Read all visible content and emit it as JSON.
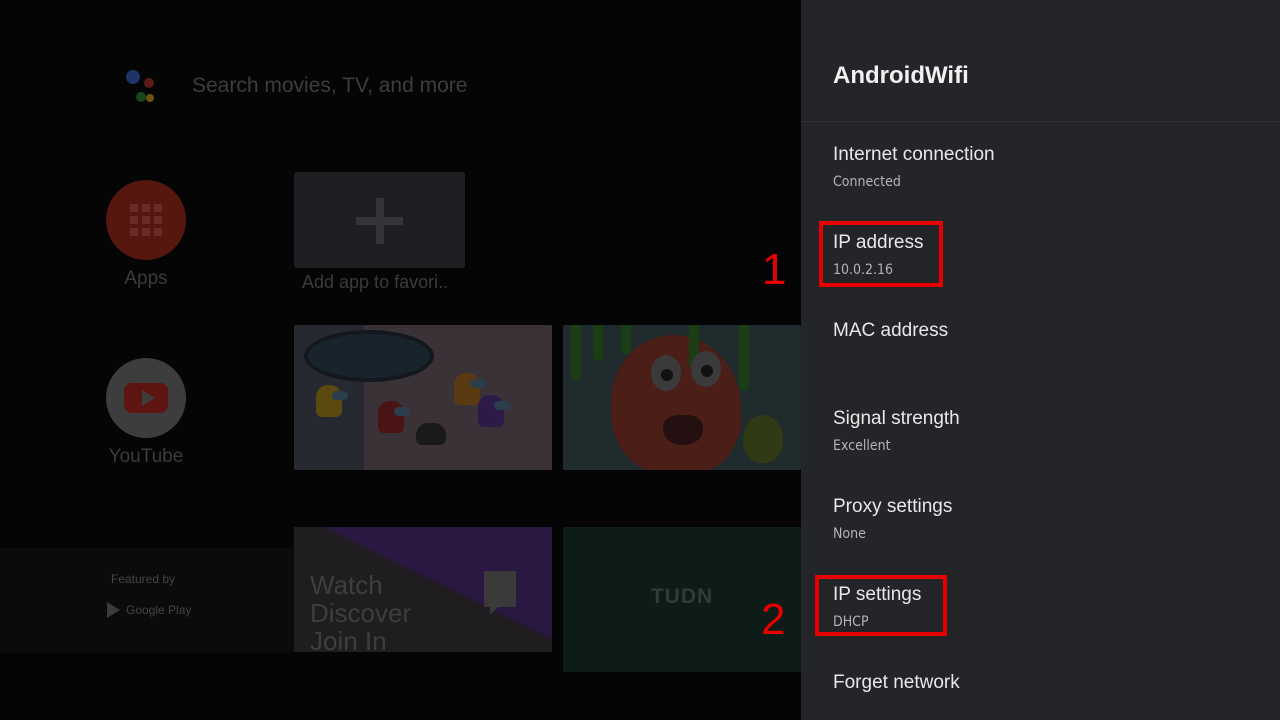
{
  "home": {
    "search_placeholder": "Search movies, TV, and more",
    "apps_label": "Apps",
    "youtube_label": "YouTube",
    "add_app_label": "Add app to favori..",
    "featured_by": "Featured by",
    "google_play": "Google Play",
    "twitch_text": "Watch\nDiscover\nJoin In",
    "tudn_text": "TUDN"
  },
  "panel": {
    "title": "AndroidWifi",
    "items": [
      {
        "title": "Internet connection",
        "value": "Connected"
      },
      {
        "title": "IP address",
        "value": "10.0.2.16"
      },
      {
        "title": "MAC address",
        "value": ""
      },
      {
        "title": "Signal strength",
        "value": "Excellent"
      },
      {
        "title": "Proxy settings",
        "value": "None"
      },
      {
        "title": "IP settings",
        "value": "DHCP"
      },
      {
        "title": "Forget network"
      }
    ]
  },
  "annotations": [
    {
      "label": "1"
    },
    {
      "label": "2"
    }
  ],
  "colors": {
    "annotation": "#e60000",
    "panel_background": "#232528"
  }
}
